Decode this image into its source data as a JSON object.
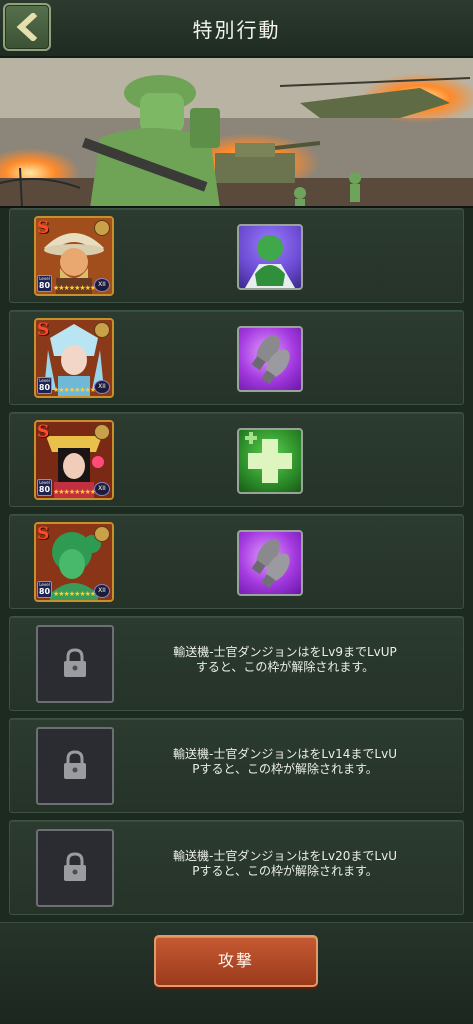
{
  "header": {
    "title": "特別行動",
    "back_icon": "chevron-left-icon"
  },
  "colors": {
    "accent_orange": "#b54a26",
    "panel_green": "#2c3b30",
    "rarity_gold": "#c8902a"
  },
  "heroes": [
    {
      "rank": "S",
      "level_label": "Level",
      "level": "80",
      "grade": "XII",
      "stars": "★★★★★★★★",
      "skill_icon": "green-soldier-icon"
    },
    {
      "rank": "S",
      "level_label": "Level",
      "level": "80",
      "grade": "XII",
      "stars": "★★★★★★★★",
      "skill_icon": "bombs-icon"
    },
    {
      "rank": "S",
      "level_label": "Level",
      "level": "80",
      "grade": "XII",
      "stars": "★★★★★★★★",
      "skill_icon": "heal-plus-icon"
    },
    {
      "rank": "S",
      "level_label": "Level",
      "level": "80",
      "grade": "XII",
      "stars": "★★★★★★★★",
      "skill_icon": "bombs-icon"
    }
  ],
  "locked_slots": [
    {
      "line1": "輸送機-士官ダンジョンはをLv9までLvUP",
      "line2": "すると、この枠が解除されます。"
    },
    {
      "line1": "輸送機-士官ダンジョンはをLv14までLvU",
      "line2": "Pすると、この枠が解除されます。"
    },
    {
      "line1": "輸送機-士官ダンジョンはをLv20までLvU",
      "line2": "Pすると、この枠が解除されます。"
    }
  ],
  "footer": {
    "attack_label": "攻撃"
  }
}
